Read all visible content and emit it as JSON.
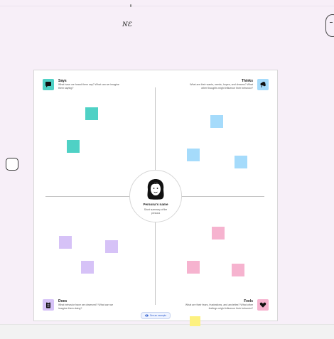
{
  "scribble": "ɴɛ",
  "says": {
    "title": "Says",
    "desc": "What have we heard them say? What can we imagine them saying?"
  },
  "thinks": {
    "title": "Thinks",
    "desc": "What are their wants, needs, hopes, and dreams? What other thoughts might influence their behavior?"
  },
  "does": {
    "title": "Does",
    "desc": "What behavior have we observed? What can we imagine them doing?"
  },
  "feels": {
    "title": "Feels",
    "desc": "What are their fears, frustrations, and anxieties? What other feelings might influence their behavior?"
  },
  "persona": {
    "name": "Persona's name",
    "summary": "Short summary of the persona"
  },
  "notes": {
    "says_1": "",
    "says_2": "",
    "thinks_1": ""
  },
  "example_button": "See an example",
  "icons": {
    "says": "speech-bubble-icon",
    "thinks": "thought-cloud-icon",
    "does": "clipboard-icon",
    "feels": "heart-icon",
    "persona": "persona-face-icon",
    "example": "eye-icon"
  },
  "colors": {
    "says": "#4fd1c5",
    "thinks": "#a5dbfb",
    "does": "#d6c2f7",
    "feels": "#f6b3cf",
    "yellow": "#fdf17f"
  }
}
